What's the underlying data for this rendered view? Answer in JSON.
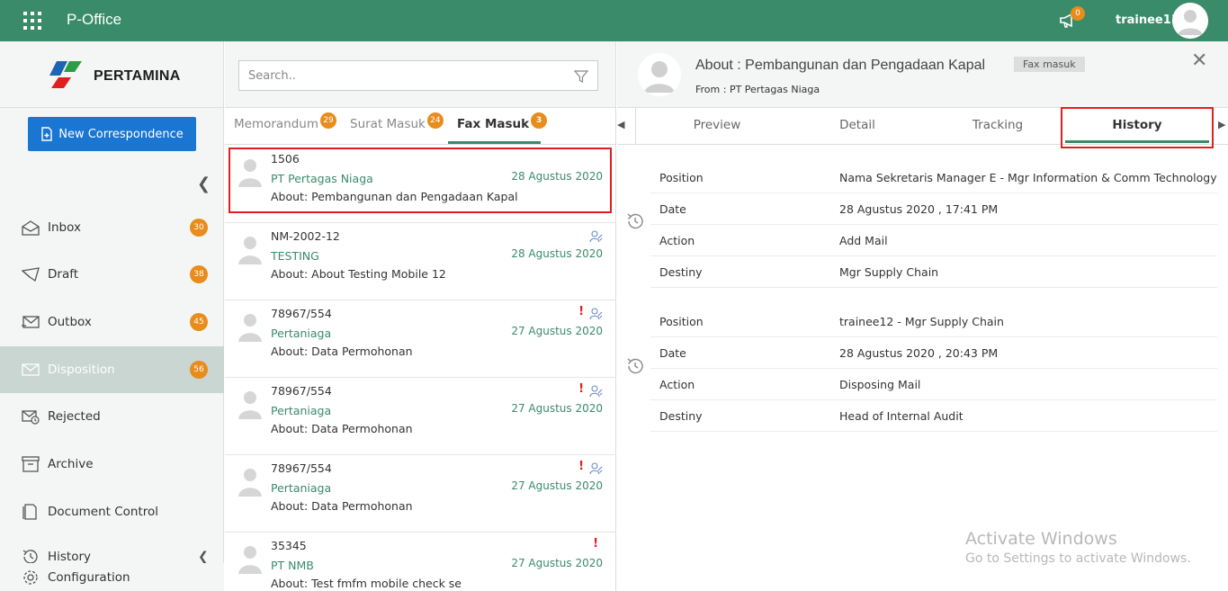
{
  "app": {
    "title": "P-Office",
    "username": "trainee11",
    "notif_count": "0"
  },
  "sidebar": {
    "logo_text": "PERTAMINA",
    "new_button": "New Correspondence",
    "items": [
      {
        "label": "Inbox",
        "badge": "30",
        "icon": "inbox-icon"
      },
      {
        "label": "Draft",
        "badge": "38",
        "icon": "draft-icon"
      },
      {
        "label": "Outbox",
        "badge": "45",
        "icon": "outbox-icon"
      },
      {
        "label": "Disposition",
        "badge": "56",
        "icon": "disposition-icon"
      },
      {
        "label": "Rejected",
        "badge": "",
        "icon": "rejected-icon"
      },
      {
        "label": "Archive",
        "badge": "",
        "icon": "archive-icon"
      },
      {
        "label": "Document Control",
        "badge": "",
        "icon": "document-icon"
      },
      {
        "label": "History",
        "badge": "",
        "icon": "history-icon"
      },
      {
        "label": "Configuration",
        "badge": "",
        "icon": "gear-icon"
      }
    ]
  },
  "search": {
    "placeholder": "Search.."
  },
  "tabs": [
    {
      "label": "Memorandum",
      "badge": "29"
    },
    {
      "label": "Surat Masuk",
      "badge": "24"
    },
    {
      "label": "Fax Masuk",
      "badge": "3"
    }
  ],
  "list": [
    {
      "number": "1506",
      "from": "PT Pertagas Niaga",
      "date": "28 Agustus 2020",
      "about": "About: Pembangunan dan Pengadaan Kapal",
      "urgent": false,
      "group": false
    },
    {
      "number": "NM-2002-12",
      "from": "TESTING",
      "date": "28 Agustus 2020",
      "about": "About: About Testing Mobile 12",
      "urgent": false,
      "group": true
    },
    {
      "number": "78967/554",
      "from": "Pertaniaga",
      "date": "27 Agustus 2020",
      "about": "About: Data Permohonan",
      "urgent": true,
      "group": true
    },
    {
      "number": "78967/554",
      "from": "Pertaniaga",
      "date": "27 Agustus 2020",
      "about": "About: Data Permohonan",
      "urgent": true,
      "group": true
    },
    {
      "number": "78967/554",
      "from": "Pertaniaga",
      "date": "27 Agustus 2020",
      "about": "About: Data Permohonan",
      "urgent": true,
      "group": true
    },
    {
      "number": "35345",
      "from": "PT NMB",
      "date": "27 Agustus 2020",
      "about": "About: Test fmfm mobile check se",
      "urgent": true,
      "group": false
    }
  ],
  "detail": {
    "title": "About : Pembangunan dan Pengadaan Kapal",
    "tag": "Fax masuk",
    "from": "From : PT Pertagas Niaga",
    "tabs": [
      "Preview",
      "Detail",
      "Tracking",
      "History"
    ],
    "history": [
      {
        "position_label": "Position",
        "position": "Nama Sekretaris Manager E - Mgr Information & Comm Technology",
        "date_label": "Date",
        "date": "28 Agustus 2020 , 17:41 PM",
        "action_label": "Action",
        "action": "Add Mail",
        "destiny_label": "Destiny",
        "destiny": "Mgr Supply Chain"
      },
      {
        "position_label": "Position",
        "position": "trainee12 - Mgr Supply Chain",
        "date_label": "Date",
        "date": "28 Agustus 2020 , 20:43 PM",
        "action_label": "Action",
        "action": "Disposing Mail",
        "destiny_label": "Destiny",
        "destiny": "Head of Internal Audit"
      }
    ]
  },
  "watermark": {
    "line1": "Activate Windows",
    "line2": "Go to Settings to activate Windows."
  },
  "colors": {
    "topbar": "#3a8b6a",
    "accent": "#3a8b6a",
    "badge": "#e88c1b",
    "primary_button": "#1976d2",
    "highlight": "#e02020"
  }
}
